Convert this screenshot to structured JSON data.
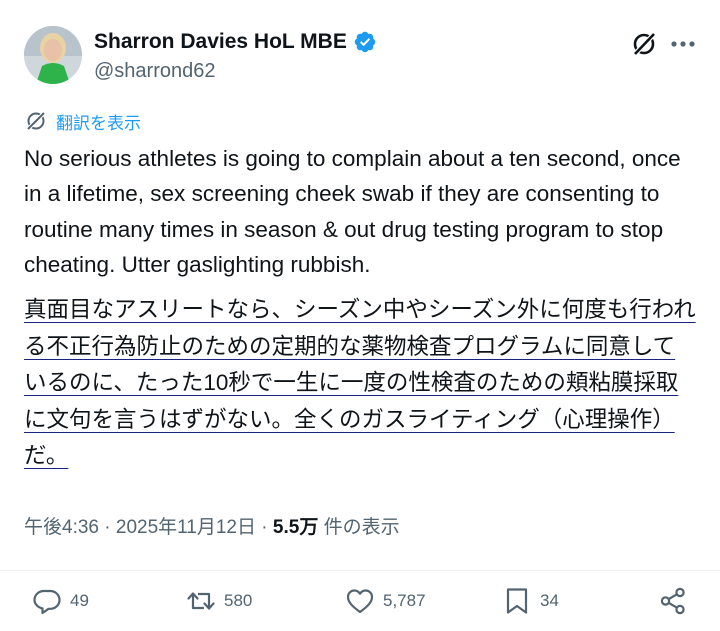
{
  "author": {
    "display_name": "Sharron Davies HoL MBE",
    "handle": "@sharrond62",
    "verified": true
  },
  "translate_label": "翻訳を表示",
  "tweet": {
    "text": "No serious athletes is going to complain about a ten second, once in a lifetime, sex screening cheek swab if they are consenting to routine many times in season & out drug testing program to stop cheating. Utter gaslighting rubbish.",
    "translated_text": "真面目なアスリートなら、シーズン中やシーズン外に何度も行われる不正行為防止のための定期的な薬物検査プログラムに同意しているのに、たった10秒で一生に一度の性検査のための頬粘膜採取に文句を言うはずがない。全くのガスライティング（心理操作）だ。"
  },
  "meta": {
    "time": "午後4:36",
    "separator1": " · ",
    "date": "2025年11月12日",
    "separator2": " · ",
    "views_count": "5.5万",
    "views_label": " 件の表示"
  },
  "actions": {
    "reply_count": "49",
    "repost_count": "580",
    "like_count": "5,787",
    "bookmark_count": "34"
  },
  "icons": {
    "verified": "verified-badge-icon",
    "grok": "grok-icon",
    "more": "more-icon",
    "translate": "translate-icon",
    "reply": "reply-icon",
    "repost": "repost-icon",
    "like": "heart-icon",
    "bookmark": "bookmark-icon",
    "share": "share-icon"
  },
  "colors": {
    "accent": "#1d9bf0",
    "secondary_text": "#536471",
    "primary_text": "#0f1419",
    "translation_underline": "#1a237e"
  }
}
